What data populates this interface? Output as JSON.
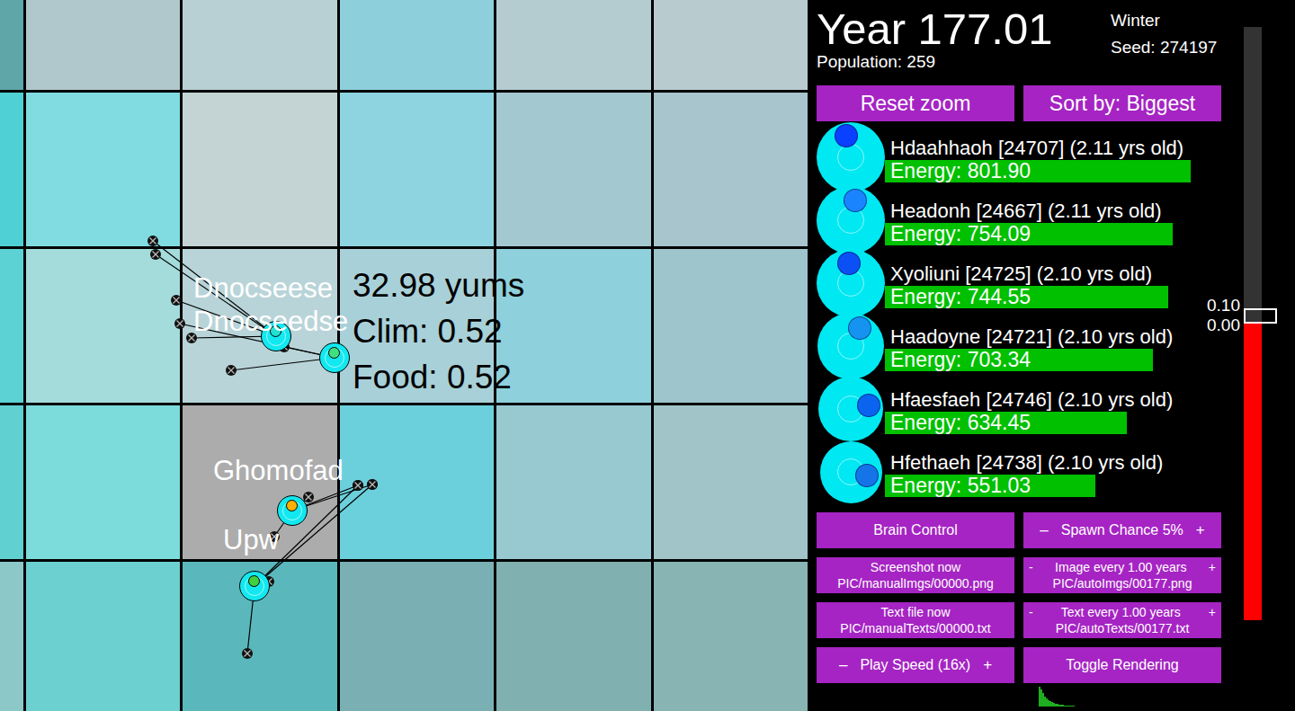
{
  "map": {
    "tiles": [
      [
        {
          "color": "#5fa6a8"
        },
        {
          "color": "#b0c8cc"
        },
        {
          "color": "#b8d0d4"
        },
        {
          "color": "#8ecfdc"
        },
        {
          "color": "#b4ccd0"
        },
        {
          "color": "#b8cccf"
        }
      ],
      [
        {
          "color": "#4fd0d4"
        },
        {
          "color": "#80dce0"
        },
        {
          "color": "#c4d4d4"
        },
        {
          "color": "#8ed4e0"
        },
        {
          "color": "#a4c8d0"
        },
        {
          "color": "#a8c4cc"
        }
      ],
      [
        {
          "color": "#5cd2d4"
        },
        {
          "color": "#a4dcdc"
        },
        {
          "color": "#b8d4d8"
        },
        {
          "color": "#a8d0d8"
        },
        {
          "color": "#8ed0dc"
        },
        {
          "color": "#9ec4cc"
        }
      ],
      [
        {
          "color": "#60d0d0"
        },
        {
          "color": "#7cdcdc"
        },
        {
          "color": "#acacac"
        },
        {
          "color": "#6cd0dc"
        },
        {
          "color": "#98c8d0"
        },
        {
          "color": "#a0c4c8"
        }
      ],
      [
        {
          "color": "#8cc8c8"
        },
        {
          "color": "#6cd0d0"
        },
        {
          "color": "#5ab8bc"
        },
        {
          "color": "#7ab0b4"
        },
        {
          "color": "#80b0b0"
        },
        {
          "color": "#88b4b4"
        }
      ]
    ],
    "creatures": [
      {
        "name": "Dnocseese",
        "dot_color": "#20e0d0"
      },
      {
        "name": "Dnocseedse",
        "dot_color": "#40e080"
      },
      {
        "name": "Ghomofad",
        "dot_color": "#ffb000"
      },
      {
        "name": "Upw",
        "dot_color": "#40d040"
      }
    ],
    "tile_info": [
      "32.98 yums",
      "Clim: 0.52",
      "Food: 0.52"
    ]
  },
  "header": {
    "year": "Year 177.01",
    "season": "Winter",
    "seed": "Seed: 274197",
    "population": "Population: 259"
  },
  "top_buttons": [
    "Reset zoom",
    "Sort by: Biggest"
  ],
  "creatures": [
    {
      "name": "Hdaahhaoh [24707] (2.11 yrs old)",
      "energy": "Energy: 801.90",
      "level": 0.944,
      "color": "#0a40ff"
    },
    {
      "name": "Headonh [24667] (2.11 yrs old)",
      "energy": "Energy: 754.09",
      "level": 0.889,
      "color": "#1a84ff"
    },
    {
      "name": "Xyoliuni [24725] (2.10 yrs old)",
      "energy": "Energy: 744.55",
      "level": 0.875,
      "color": "#0a50f5"
    },
    {
      "name": "Haadoyne [24721] (2.10 yrs old)",
      "energy": "Energy: 703.34",
      "level": 0.828,
      "color": "#1494f0"
    },
    {
      "name": "Hfaesfaeh [24746] (2.10 yrs old)",
      "energy": "Energy: 634.45",
      "level": 0.747,
      "color": "#0a64f0"
    },
    {
      "name": "Hfethaeh [24738] (2.10 yrs old)",
      "energy": "Energy: 551.03",
      "level": 0.65,
      "color": "#1474e8"
    }
  ],
  "controls": [
    {
      "kind": "plain",
      "label": "Brain Control"
    },
    {
      "kind": "stepper",
      "minus": "–",
      "label": "Spawn Chance 5%",
      "plus": "+"
    },
    {
      "kind": "action",
      "label": "Screenshot now",
      "path": "PIC/manualImgs/00000.png"
    },
    {
      "kind": "stepper-path",
      "minus": "-",
      "label": "Image every 1.00 years",
      "plus": "+",
      "path": "PIC/autoImgs/00177.png"
    },
    {
      "kind": "action",
      "label": "Text file now",
      "path": "PIC/manualTexts/00000.txt"
    },
    {
      "kind": "stepper-path",
      "minus": "-",
      "label": "Text every 1.00 years",
      "plus": "+",
      "path": "PIC/autoTexts/00177.txt"
    },
    {
      "kind": "stepper",
      "minus": "–",
      "label": "Play Speed (16x)",
      "plus": "+"
    },
    {
      "kind": "plain",
      "label": "Toggle Rendering"
    }
  ],
  "slider": {
    "labels": [
      "0.10",
      "0.00"
    ],
    "level": 0.5
  },
  "histogram": [
    22,
    19,
    15,
    11,
    9,
    7,
    6,
    5,
    4,
    3,
    3,
    2,
    2,
    2,
    1,
    1,
    1,
    1,
    1,
    1
  ]
}
